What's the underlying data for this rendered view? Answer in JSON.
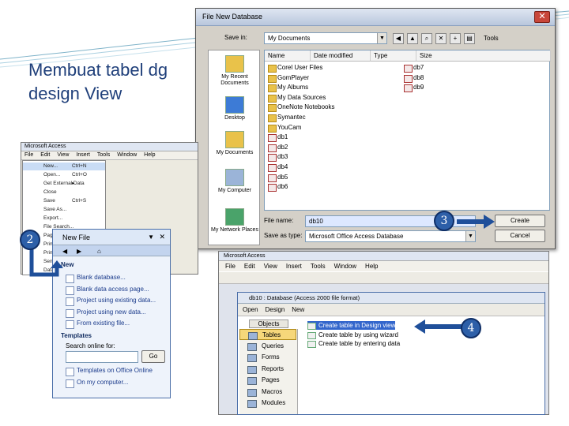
{
  "slide": {
    "title": "Membuat tabel dg design View"
  },
  "new_db_dialog": {
    "title": "File New Database",
    "save_in_label": "Save in:",
    "save_in_value": "My Documents",
    "tools_label": "Tools",
    "places": [
      "My Recent Documents",
      "Desktop",
      "My Documents",
      "My Computer",
      "My Network Places"
    ],
    "columns": [
      "Name",
      "Date modified",
      "Type",
      "Size"
    ],
    "files": [
      "Corel User Files",
      "GomPlayer",
      "My Albums",
      "My Data Sources",
      "OneNote Notebooks",
      "Symantec",
      "YouCam",
      "db1",
      "db2",
      "db3",
      "db4",
      "db5",
      "db6"
    ],
    "files_right": [
      "db7",
      "db8",
      "db9"
    ],
    "filename_label": "File name:",
    "filename_value": "db10",
    "type_label": "Save as type:",
    "type_value": "Microsoft Office Access Database",
    "create_label": "Create",
    "cancel_label": "Cancel"
  },
  "access_left": {
    "title": "Microsoft Access",
    "menu": [
      "File",
      "Edit",
      "View",
      "Insert",
      "Tools",
      "Window",
      "Help"
    ],
    "file_menu": [
      {
        "label": "New...",
        "shortcut": "Ctrl+N"
      },
      {
        "label": "Open...",
        "shortcut": "Ctrl+O"
      },
      {
        "label": "Get External Data",
        "shortcut": "▸"
      },
      {
        "label": "Close",
        "shortcut": ""
      },
      {
        "label": "Save",
        "shortcut": "Ctrl+S"
      },
      {
        "label": "Save As...",
        "shortcut": ""
      },
      {
        "label": "Export...",
        "shortcut": ""
      },
      {
        "label": "File Search...",
        "shortcut": ""
      },
      {
        "label": "Page Setup...",
        "shortcut": ""
      },
      {
        "label": "Print Preview",
        "shortcut": ""
      },
      {
        "label": "Print...",
        "shortcut": ""
      },
      {
        "label": "Send To",
        "shortcut": ""
      },
      {
        "label": "Database Properties",
        "shortcut": ""
      }
    ]
  },
  "new_file_pane": {
    "title": "New File",
    "section_new": "New",
    "links": [
      "Blank database...",
      "Blank data access page...",
      "Project using existing data...",
      "Project using new data...",
      "From existing file..."
    ],
    "section_templates": "Templates",
    "search_label": "Search online for:",
    "go_label": "Go",
    "template_links": [
      "Templates on Office Online",
      "On my computer..."
    ]
  },
  "access_right": {
    "title": "Microsoft Access",
    "menu": [
      "File",
      "Edit",
      "View",
      "Insert",
      "Tools",
      "Window",
      "Help"
    ],
    "db_title": "db10 : Database (Access 2000 file format)",
    "db_tools": [
      "Open",
      "Design",
      "New"
    ],
    "objects_label": "Objects",
    "objects": [
      "Tables",
      "Queries",
      "Forms",
      "Reports",
      "Pages",
      "Macros",
      "Modules"
    ],
    "create_items": [
      "Create table in Design view",
      "Create table by using wizard",
      "Create table by entering data"
    ]
  },
  "steps": [
    "2",
    "3",
    "4"
  ],
  "colors": {
    "accent": "#2d5fa8",
    "title": "#1f3f7a",
    "highlight": "#3366cc"
  }
}
